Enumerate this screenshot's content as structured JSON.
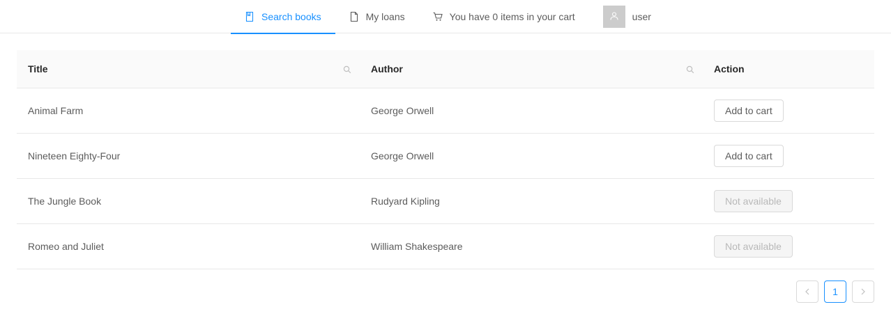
{
  "nav": {
    "items": [
      {
        "label": "Search books",
        "icon": "book-icon",
        "active": true
      },
      {
        "label": "My loans",
        "icon": "file-icon",
        "active": false
      },
      {
        "label": "You have 0 items in your cart",
        "icon": "cart-icon",
        "active": false
      }
    ],
    "user": {
      "name": "user",
      "icon": "user-icon"
    }
  },
  "table": {
    "columns": [
      {
        "label": "Title",
        "searchable": true
      },
      {
        "label": "Author",
        "searchable": true
      },
      {
        "label": "Action",
        "searchable": false
      }
    ],
    "rows": [
      {
        "title": "Animal Farm",
        "author": "George Orwell",
        "action": "Add to cart",
        "available": true
      },
      {
        "title": "Nineteen Eighty-Four",
        "author": "George Orwell",
        "action": "Add to cart",
        "available": true
      },
      {
        "title": "The Jungle Book",
        "author": "Rudyard Kipling",
        "action": "Not available",
        "available": false
      },
      {
        "title": "Romeo and Juliet",
        "author": "William Shakespeare",
        "action": "Not available",
        "available": false
      }
    ]
  },
  "pagination": {
    "current_page": "1",
    "prev_icon": "chevron-left-icon",
    "next_icon": "chevron-right-icon"
  },
  "colors": {
    "accent": "#1890ff",
    "border": "#e8e8e8",
    "header_bg": "#fafafa",
    "avatar_bg": "#cccccc"
  }
}
